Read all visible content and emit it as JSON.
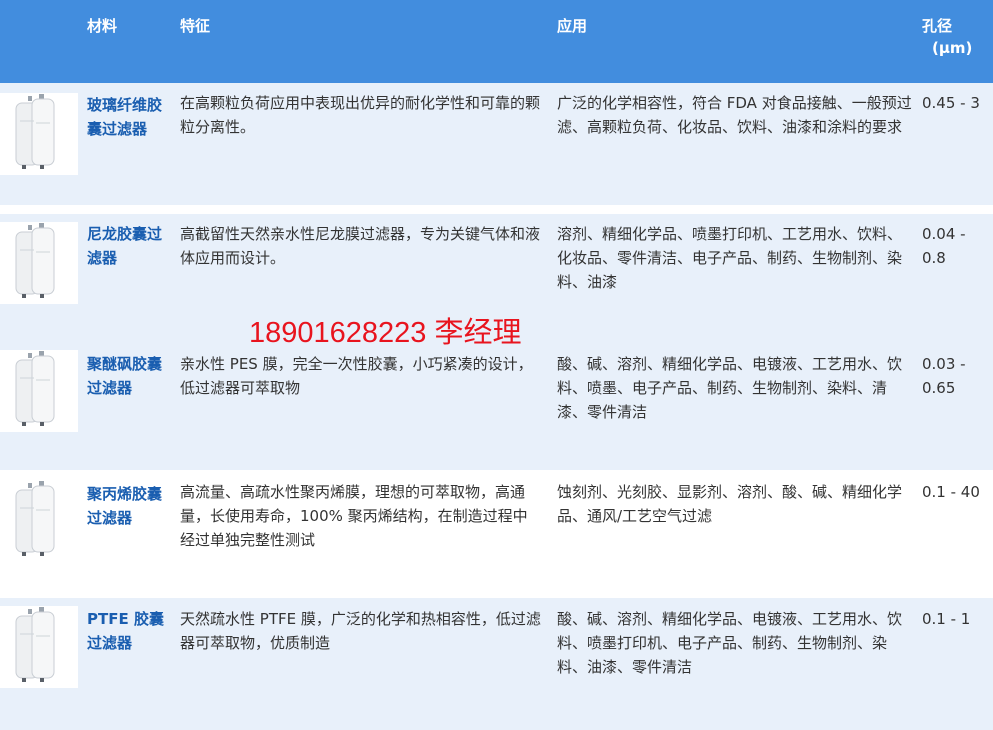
{
  "header": {
    "material": "材料",
    "feature": "特征",
    "application": "应用",
    "pore_line1": "孔径",
    "pore_line2": "(μm)"
  },
  "rows": [
    {
      "name": "玻璃纤维胶囊过滤器",
      "feature": "在高颗粒负荷应用中表现出优异的耐化学性和可靠的颗粒分离性。",
      "application": "广泛的化学相容性，符合 FDA 对食品接触、一般预过滤、高颗粒负荷、化妆品、饮料、油漆和涂料的要求",
      "pore": "0.45 - 3"
    },
    {
      "name": "尼龙胶囊过滤器",
      "feature": "高截留性天然亲水性尼龙膜过滤器，专为关键气体和液体应用而设计。",
      "application": "溶剂、精细化学品、喷墨打印机、工艺用水、饮料、化妆品、零件清洁、电子产品、制药、生物制剂、染料、油漆",
      "pore": "0.04 - 0.8"
    },
    {
      "name": "聚醚砜胶囊过滤器",
      "feature": "亲水性 PES 膜，完全一次性胶囊，小巧紧凑的设计，低过滤器可萃取物",
      "application": "酸、碱、溶剂、精细化学品、电镀液、工艺用水、饮料、喷墨、电子产品、制药、生物制剂、染料、清漆、零件清洁",
      "pore": "0.03 - 0.65"
    },
    {
      "name": "聚丙烯胶囊过滤器",
      "feature": "高流量、高疏水性聚丙烯膜，理想的可萃取物，高通量，长使用寿命，100% 聚丙烯结构，在制造过程中经过单独完整性测试",
      "application": "蚀刻剂、光刻胶、显影剂、溶剂、酸、碱、精细化学品、通风/工艺空气过滤",
      "pore": "0.1 - 40"
    },
    {
      "name": "PTFE 胶囊过滤器",
      "feature": "天然疏水性 PTFE 膜，广泛的化学和热相容性，低过滤器可萃取物，优质制造",
      "application": "酸、碱、溶剂、精细化学品、电镀液、工艺用水、饮料、喷墨打印机、电子产品、制药、生物制剂、染料、油漆、零件清洁",
      "pore": "0.1 - 1"
    }
  ],
  "watermark": "18901628223 李经理",
  "colors": {
    "header_bg": "#428dde",
    "row_bg": "#e8f0fa",
    "name_text": "#1a5eb0",
    "watermark": "#e8141e"
  },
  "icons": {
    "product_image": "capsule-filter-icon"
  }
}
